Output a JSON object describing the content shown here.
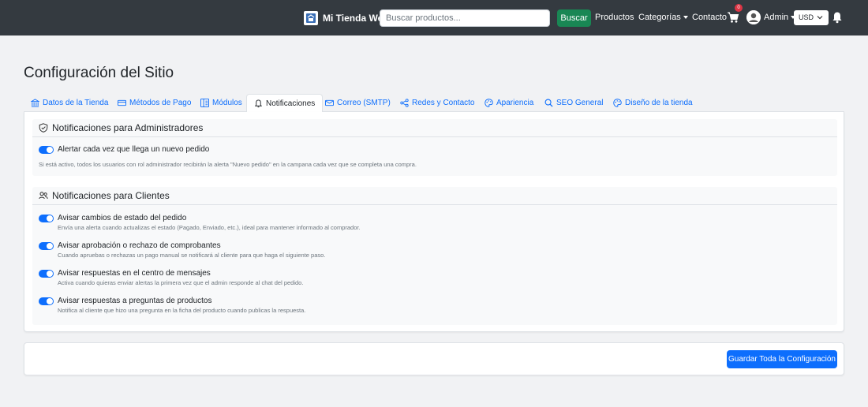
{
  "navbar": {
    "brand": "Mi Tienda Web",
    "search_placeholder": "Buscar productos...",
    "search_button": "Buscar",
    "links": {
      "products": "Productos",
      "categories": "Categorías",
      "contact": "Contacto"
    },
    "cart_count": "0",
    "user": "Admin",
    "currency": "USD",
    "icons": [
      "store-logo-icon",
      "cart-icon",
      "user-avatar-icon",
      "chevron-down-icon",
      "bell-icon"
    ]
  },
  "page": {
    "title": "Configuración del Sitio"
  },
  "tabs": [
    {
      "label": "Datos de la Tienda",
      "icon": "bank-icon",
      "active": false
    },
    {
      "label": "Métodos de Pago",
      "icon": "credit-card-icon",
      "active": false
    },
    {
      "label": "Módulos",
      "icon": "modules-icon",
      "active": false
    },
    {
      "label": "Notificaciones",
      "icon": "bell-icon",
      "active": true
    },
    {
      "label": "Correo (SMTP)",
      "icon": "envelope-icon",
      "active": false
    },
    {
      "label": "Redes y Contacto",
      "icon": "share-icon",
      "active": false
    },
    {
      "label": "Apariencia",
      "icon": "palette-icon",
      "active": false
    },
    {
      "label": "SEO General",
      "icon": "search-icon",
      "active": false
    },
    {
      "label": "Diseño de la tienda",
      "icon": "palette-icon",
      "active": false
    }
  ],
  "admin_section": {
    "title": "Notificaciones para Administradores",
    "option_label": "Alertar cada vez que llega un nuevo pedido",
    "option_checked": true,
    "note": "Si está activo, todos los usuarios con rol administrador recibirán la alerta \"Nuevo pedido\" en la campana cada vez que se completa una compra."
  },
  "client_section": {
    "title": "Notificaciones para Clientes",
    "options": [
      {
        "label": "Avisar cambios de estado del pedido",
        "help": "Envía una alerta cuando actualizas el estado (Pagado, Enviado, etc.), ideal para mantener informado al comprador.",
        "checked": true
      },
      {
        "label": "Avisar aprobación o rechazo de comprobantes",
        "help": "Cuando apruebas o rechazas un pago manual se notificará al cliente para que haga el siguiente paso.",
        "checked": true
      },
      {
        "label": "Avisar respuestas en el centro de mensajes",
        "help": "Activa cuando quieras enviar alertas la primera vez que el admin responde al chat del pedido.",
        "checked": true
      },
      {
        "label": "Avisar respuestas a preguntas de productos",
        "help": "Notifica al cliente que hizo una pregunta en la ficha del producto cuando publicas la respuesta.",
        "checked": true
      }
    ]
  },
  "footer": {
    "save_button": "Guardar Toda la Configuración"
  },
  "colors": {
    "navbar": "#343a40",
    "primary": "#0d6efd",
    "success": "#198754",
    "danger": "#dc3545"
  }
}
